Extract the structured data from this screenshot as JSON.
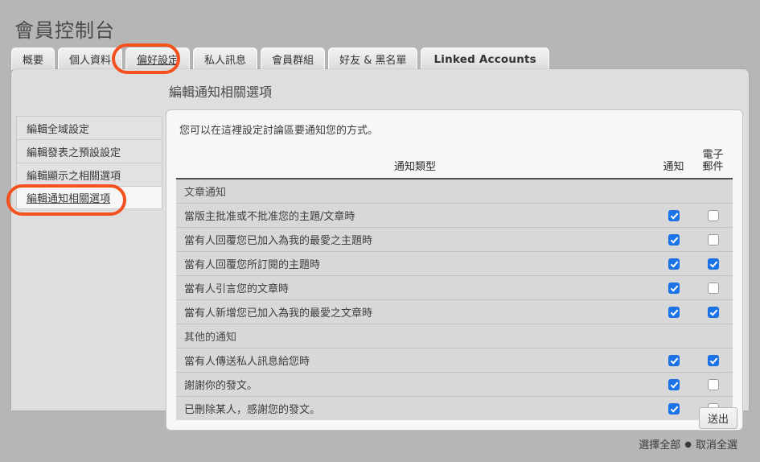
{
  "page": {
    "title": "會員控制台"
  },
  "tabs": [
    {
      "label": "概要",
      "active": false,
      "latin": false
    },
    {
      "label": "個人資料",
      "active": false,
      "latin": false
    },
    {
      "label": "偏好設定",
      "active": true,
      "latin": false
    },
    {
      "label": "私人訊息",
      "active": false,
      "latin": false
    },
    {
      "label": "會員群組",
      "active": false,
      "latin": false
    },
    {
      "label": "好友 & 黑名單",
      "active": false,
      "latin": false
    },
    {
      "label": "Linked Accounts",
      "active": false,
      "latin": true
    }
  ],
  "sidebar": {
    "items": [
      {
        "label": "編輯全域設定",
        "active": false
      },
      {
        "label": "編輯發表之預設設定",
        "active": false
      },
      {
        "label": "編輯顯示之相關選項",
        "active": false
      },
      {
        "label": "編輯通知相關選項",
        "active": true
      }
    ]
  },
  "content": {
    "title": "編輯通知相關選項",
    "intro": "您可以在這裡設定討論區要通知您的方式。",
    "columns": {
      "type": "通知類型",
      "notify": "通知",
      "email_line1": "電子",
      "email_line2": "郵件"
    },
    "rows": [
      {
        "kind": "section",
        "label": "文章通知"
      },
      {
        "kind": "item",
        "label": "當版主批准或不批准您的主題/文章時",
        "notify": true,
        "email": false
      },
      {
        "kind": "item",
        "label": "當有人回覆您已加入為我的最愛之主題時",
        "notify": true,
        "email": false
      },
      {
        "kind": "item",
        "label": "當有人回覆您所訂閱的主題時",
        "notify": true,
        "email": true
      },
      {
        "kind": "item",
        "label": "當有人引言您的文章時",
        "notify": true,
        "email": false
      },
      {
        "kind": "item",
        "label": "當有人新增您已加入為我的最愛之文章時",
        "notify": true,
        "email": true
      },
      {
        "kind": "section",
        "label": "其他的通知"
      },
      {
        "kind": "item",
        "label": "當有人傳送私人訊息給您時",
        "notify": true,
        "email": true
      },
      {
        "kind": "item",
        "label": "謝謝你的發文。",
        "notify": true,
        "email": false
      },
      {
        "kind": "item",
        "label": "已刪除某人，感謝您的發文。",
        "notify": true,
        "email": false
      }
    ]
  },
  "footer": {
    "submit_label": "送出",
    "select_all_label": "選擇全部",
    "separator": "●",
    "deselect_all_label": "取消全選"
  },
  "annotations": {
    "color": "#f4511e",
    "targets": [
      "tab-preferences",
      "sidebar-item-notifications"
    ]
  }
}
